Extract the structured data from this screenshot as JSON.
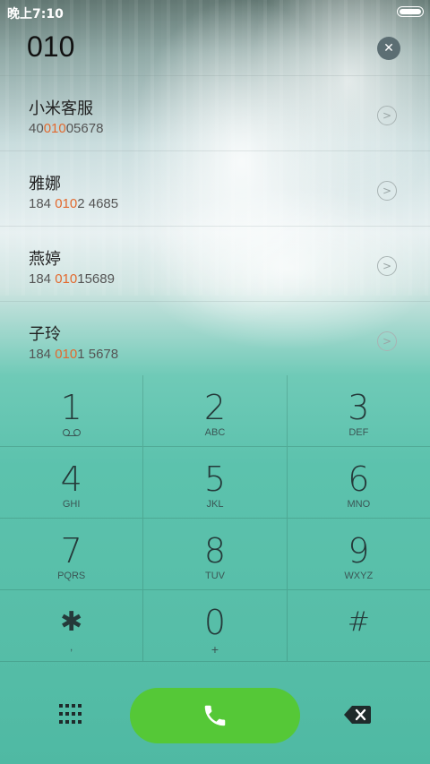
{
  "status_bar": {
    "time": "晚上7:10"
  },
  "dial_input": {
    "value": "010"
  },
  "results": [
    {
      "name": "小米客服",
      "number_prefix": "40",
      "number_match": "010",
      "number_suffix": "05678"
    },
    {
      "name": "雅娜",
      "number_prefix": "184 ",
      "number_match": "010",
      "number_suffix": "2 4685"
    },
    {
      "name": "燕婷",
      "number_prefix": "184 ",
      "number_match": "010",
      "number_suffix": "15689"
    },
    {
      "name": "子玲",
      "number_prefix": "184 ",
      "number_match": "010",
      "number_suffix": "1 5678"
    }
  ],
  "keypad": {
    "k1": {
      "digit": "1",
      "letters": ""
    },
    "k2": {
      "digit": "2",
      "letters": "ABC"
    },
    "k3": {
      "digit": "3",
      "letters": "DEF"
    },
    "k4": {
      "digit": "4",
      "letters": "GHI"
    },
    "k5": {
      "digit": "5",
      "letters": "JKL"
    },
    "k6": {
      "digit": "6",
      "letters": "MNO"
    },
    "k7": {
      "digit": "7",
      "letters": "PQRS"
    },
    "k8": {
      "digit": "8",
      "letters": "TUV"
    },
    "k9": {
      "digit": "9",
      "letters": "WXYZ"
    },
    "kstar": {
      "digit": "✱",
      "letters": ","
    },
    "k0": {
      "digit": "0",
      "letters": "+"
    },
    "khash": {
      "digit": "#",
      "letters": ""
    }
  },
  "icons": {
    "clear": "close-icon",
    "detail": "chevron-right-icon",
    "voicemail": "voicemail-icon",
    "dialpad": "dialpad-icon",
    "call": "phone-icon",
    "backspace": "backspace-icon"
  },
  "colors": {
    "highlight": "#e2692e",
    "call_button": "#55c837"
  }
}
